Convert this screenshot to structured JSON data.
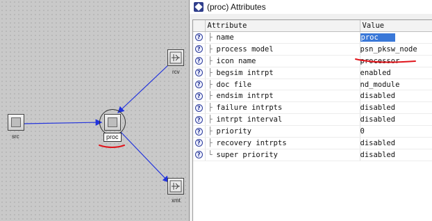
{
  "window": {
    "title": "(proc) Attributes"
  },
  "canvas": {
    "nodes": {
      "src": "src",
      "proc": "proc",
      "rcv": "rcv",
      "xmt": "xmt"
    }
  },
  "table": {
    "headers": {
      "attribute": "Attribute",
      "value": "Value"
    },
    "rows": [
      {
        "attribute": "name",
        "value": "proc"
      },
      {
        "attribute": "process model",
        "value": "psn_pksw_node"
      },
      {
        "attribute": "icon name",
        "value": "processor"
      },
      {
        "attribute": "begsim intrpt",
        "value": "enabled"
      },
      {
        "attribute": "doc file",
        "value": "nd_module"
      },
      {
        "attribute": "endsim intrpt",
        "value": "disabled"
      },
      {
        "attribute": "failure intrpts",
        "value": "disabled"
      },
      {
        "attribute": "intrpt interval",
        "value": "disabled"
      },
      {
        "attribute": "priority",
        "value": "0"
      },
      {
        "attribute": "recovery intrpts",
        "value": "disabled"
      },
      {
        "attribute": "super priority",
        "value": "disabled"
      }
    ],
    "help_glyph": "?"
  },
  "colors": {
    "link": "#2233dd",
    "annotation": "#e0141a",
    "selection": "#3a78d8"
  }
}
